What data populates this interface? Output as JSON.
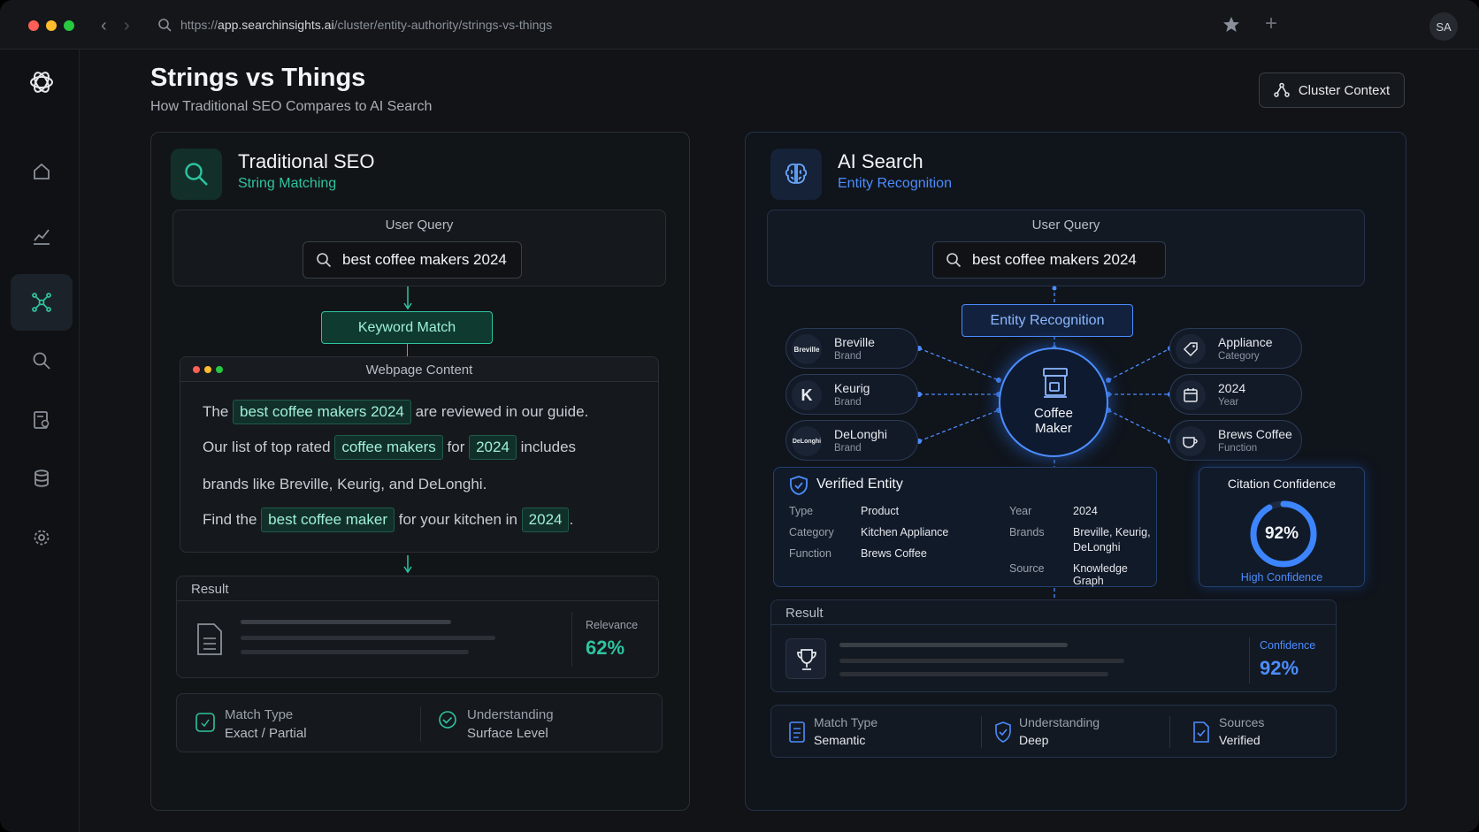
{
  "browser": {
    "url_prefix": "https://",
    "url_host": "app.searchinsights.ai",
    "url_path": "/cluster/entity-authority/strings-vs-things",
    "avatar": "SA"
  },
  "sidebar": {
    "icons": [
      "logo-icon",
      "home-icon",
      "chart-icon",
      "network-icon",
      "search-icon",
      "report-icon",
      "database-icon",
      "gear-icon"
    ],
    "active": "network-icon"
  },
  "header": {
    "title": "Strings vs Things",
    "subtitle": "How Traditional SEO Compares to AI Search",
    "context_button": "Cluster Context"
  },
  "left": {
    "title": "Traditional SEO",
    "subtitle": "String Matching",
    "accent": "#2ec4a0",
    "query_label": "User Query",
    "query": "best coffee makers 2024",
    "match_label": "Keyword Match",
    "webpage_label": "Webpage Content",
    "content": {
      "l1_pre": "The",
      "l1_hl": "best coffee makers 2024",
      "l1_post": "are reviewed in our guide.",
      "l2_pre": "Our list of top rated",
      "l2_hl1": "coffee makers",
      "l2_mid": "for",
      "l2_hl2": "2024",
      "l2_post": "includes",
      "l3": "brands like Breville, Keurig, and DeLonghi.",
      "l4_pre": "Find the",
      "l4_hl1": "best coffee maker",
      "l4_mid": "for your kitchen in",
      "l4_hl2": "2024",
      "l4_post": "."
    },
    "result_label": "Result",
    "relevance_label": "Relevance",
    "relevance_value": "62%",
    "relevance_fraction": 0.62,
    "footer": [
      {
        "label": "Match Type",
        "value": "Exact / Partial"
      },
      {
        "label": "Understanding",
        "value": "Surface Level"
      }
    ]
  },
  "right": {
    "title": "AI Search",
    "subtitle": "Entity Recognition",
    "accent": "#4c8dff",
    "query_label": "User Query",
    "query": "best coffee makers 2024",
    "entity_label": "Entity Recognition",
    "center": "Coffee Maker",
    "left_nodes": [
      {
        "name": "Breville",
        "type": "Brand",
        "mark": "Breville"
      },
      {
        "name": "Keurig",
        "type": "Brand",
        "mark": "K"
      },
      {
        "name": "DeLonghi",
        "type": "Brand",
        "mark": "DeLonghi"
      }
    ],
    "right_nodes": [
      {
        "name": "Appliance",
        "type": "Category"
      },
      {
        "name": "2024",
        "type": "Year"
      },
      {
        "name": "Brews Coffee",
        "type": "Function"
      }
    ],
    "verified": {
      "title": "Verified Entity",
      "type_k": "Type",
      "type_v": "Product",
      "category_k": "Category",
      "category_v": "Kitchen Appliance",
      "function_k": "Function",
      "function_v": "Brews Coffee",
      "year_k": "Year",
      "year_v": "2024",
      "brands_k": "Brands",
      "brands_v1": "Breville, Keurig,",
      "brands_v2": "DeLonghi",
      "source_k": "Source",
      "source_v": "Knowledge Graph"
    },
    "citation": {
      "title": "Citation Confidence",
      "value": "92%",
      "fraction": 0.92,
      "caption": "High Confidence"
    },
    "result_label": "Result",
    "confidence_label": "Confidence",
    "confidence_value": "92%",
    "footer": [
      {
        "label": "Match Type",
        "value": "Semantic"
      },
      {
        "label": "Understanding",
        "value": "Deep"
      },
      {
        "label": "Sources",
        "value": "Verified"
      }
    ]
  }
}
